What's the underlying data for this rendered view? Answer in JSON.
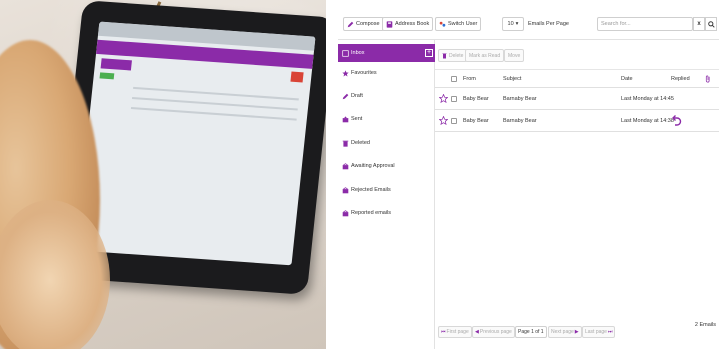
{
  "toolbar": {
    "compose_label": "Compose",
    "address_book_label": "Address Book",
    "switch_user_label": "Switch User",
    "per_page_value": "10",
    "per_page_label": "Emails Per Page",
    "search_placeholder": "Search for...",
    "clear_symbol": "x"
  },
  "sidebar": {
    "items": [
      {
        "label": "Inbox",
        "icon": "inbox-icon"
      },
      {
        "label": "Favourites",
        "icon": "star-icon"
      },
      {
        "label": "Draft",
        "icon": "pencil-icon"
      },
      {
        "label": "Sent",
        "icon": "sent-icon"
      },
      {
        "label": "Deleted",
        "icon": "trash-icon"
      },
      {
        "label": "Awaiting Approval",
        "icon": "awaiting-icon"
      },
      {
        "label": "Rejected Emails",
        "icon": "rejected-icon"
      },
      {
        "label": "Reported emails",
        "icon": "reported-icon"
      }
    ]
  },
  "actions": {
    "delete_label": "Delete",
    "mark_read_label": "Mark as Read",
    "move_label": "Move"
  },
  "table": {
    "columns": {
      "from": "From",
      "subject": "Subject",
      "date": "Date",
      "replied": "Replied"
    },
    "rows": [
      {
        "from": "Baby Bear",
        "subject": "Barnaby Bear",
        "date": "Last Monday at 14:45",
        "replied": false
      },
      {
        "from": "Baby Bear",
        "subject": "Barnaby Bear",
        "date": "Last Monday at 14:38",
        "replied": true
      }
    ]
  },
  "pager": {
    "first": "First page",
    "previous": "Previous page",
    "info": "Page 1 of 1",
    "next": "Next page",
    "last": "Last page",
    "count": "2 Emails"
  },
  "colors": {
    "accent": "#8b2ba8",
    "compose_icon": "#8b2ba8",
    "star": "#8b2ba8"
  }
}
